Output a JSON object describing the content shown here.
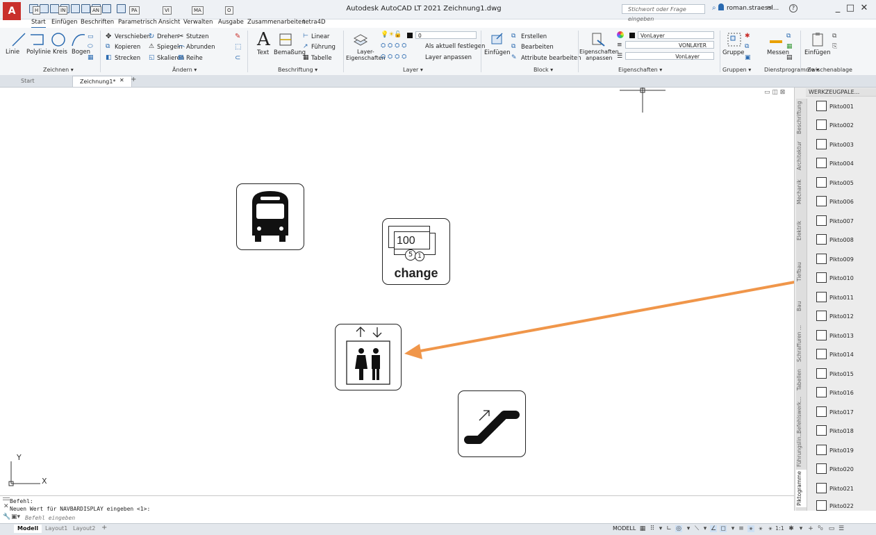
{
  "window": {
    "title": "Autodesk AutoCAD LT 2021   Zeichnung1.dwg",
    "search_placeholder": "Stichwort oder Frage eingeben",
    "user": "roman.straessl...",
    "help": "?",
    "minimize": "_",
    "maximize": "□",
    "close": "✕"
  },
  "app_logo": "A",
  "ribbon_tabs": [
    {
      "label": "Start",
      "key": "H"
    },
    {
      "label": "Einfügen",
      "key": "IN"
    },
    {
      "label": "Beschriften",
      "key": "AN"
    },
    {
      "label": "Parametrisch",
      "key": "PA"
    },
    {
      "label": "Ansicht",
      "key": "VI"
    },
    {
      "label": "Verwalten",
      "key": "MA"
    },
    {
      "label": "Ausgabe",
      "key": "O"
    },
    {
      "label": "Zusammenarbeiten",
      "key": ""
    },
    {
      "label": "tetra4D",
      "key": ""
    }
  ],
  "ribbon": {
    "draw": {
      "line": "Linie",
      "polyline": "Polylinie",
      "circle": "Kreis",
      "arc": "Bogen",
      "title": "Zeichnen ▾"
    },
    "modify": {
      "move": "Verschieben",
      "rotate": "Drehen",
      "trim": "Stutzen",
      "copy": "Kopieren",
      "mirror": "Spiegeln",
      "fillet": "Abrunden",
      "stretch": "Strecken",
      "scale": "Skalieren",
      "array": "Reihe",
      "title": "Ändern ▾"
    },
    "annotation": {
      "text": "Text",
      "dimension": "Bemaßung",
      "linear": "Linear",
      "leader": "Führung",
      "table": "Tabelle",
      "title": "Beschriftung ▾"
    },
    "layers": {
      "properties": "Layer-\nEigenschaften",
      "current_layer": "0",
      "make_current": "Als aktuell festlegen",
      "match_layer": "Layer anpassen",
      "title": "Layer ▾"
    },
    "block": {
      "insert": "Einfügen",
      "create": "Erstellen",
      "edit": "Bearbeiten",
      "edit_attributes": "Attribute bearbeiten",
      "title": "Block ▾"
    },
    "properties": {
      "match": "Eigenschaften\nanpassen",
      "color": "VonLayer",
      "linetype": "VONLAYER",
      "lineweight": "VonLayer",
      "title": "Eigenschaften ▾"
    },
    "groups": {
      "group": "Gruppe",
      "title": "Gruppen ▾"
    },
    "utilities": {
      "measure": "Messen",
      "title": "Dienstprogramme ▾"
    },
    "clipboard": {
      "paste": "Einfügen",
      "title": "Zwischenablage"
    }
  },
  "doc_tabs": [
    {
      "label": "Start",
      "active": false
    },
    {
      "label": "Zeichnung1*",
      "active": true
    }
  ],
  "doc_tab_close": "✕",
  "doc_tab_add": "+",
  "canvas": {
    "picto_change": {
      "amount": "100",
      "coin1": "5",
      "coin2": "1",
      "word": "change"
    },
    "ucs": {
      "x_label": "X",
      "y_label": "Y"
    },
    "viewport_controls": "▭ ◫ ⊠",
    "arrow_color": "#f0964a"
  },
  "palette": {
    "title": "WERKZEUGPALE...",
    "tabs": [
      "Beschriftung",
      "Architektur",
      "Mechanik",
      "Elektrik",
      "Tiefbau",
      "Bau",
      "Schraffuren ...",
      "Tabellen",
      "Befehlswerk...",
      "Führungslin...",
      "Piktogramme"
    ],
    "active_tab": "Piktogramme",
    "items": [
      "Pikto001",
      "Pikto002",
      "Pikto003",
      "Pikto004",
      "Pikto005",
      "Pikto006",
      "Pikto007",
      "Pikto008",
      "Pikto009",
      "Pikto010",
      "Pikto011",
      "Pikto012",
      "Pikto013",
      "Pikto014",
      "Pikto015",
      "Pikto016",
      "Pikto017",
      "Pikto018",
      "Pikto019",
      "Pikto020",
      "Pikto021",
      "Pikto022"
    ]
  },
  "command": {
    "history1": "Befehl:",
    "history2": "Neuen Wert für NAVBARDISPLAY eingeben <1>:",
    "placeholder": "Befehl eingeben"
  },
  "layout_tabs": [
    "Modell",
    "Layout1",
    "Layout2"
  ],
  "layout_add": "+",
  "status": {
    "model": "MODELL",
    "scale": "1:1"
  }
}
